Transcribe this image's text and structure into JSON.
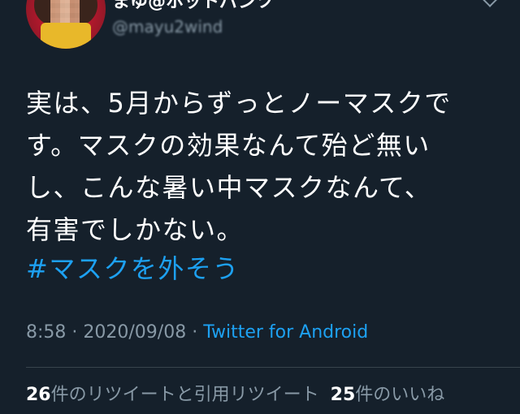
{
  "header": {
    "display_name": "まゆ@ホットパンツ",
    "handle": "@mayu2wind",
    "avatar_icon": "user-avatar",
    "menu_icon": "chevron-down-icon"
  },
  "tweet": {
    "lines": [
      "実は、5月からずっとノーマスクで",
      "す。マスクの効果なんて殆ど無い",
      "し、こんな暑い中マスクなんて、",
      "有害でしかない。"
    ],
    "hashtag": "#マスクを外そう"
  },
  "meta": {
    "time": "8:58",
    "sep1": " · ",
    "date": "2020/09/08",
    "sep2": " · ",
    "source": "Twitter for Android"
  },
  "stats": {
    "retweet_count": "26",
    "retweet_label": "件のリツイートと引用リツイート",
    "like_count": "25",
    "like_label": "件のいいね"
  },
  "colors": {
    "background": "#15202b",
    "text": "#ffffff",
    "secondary": "#8899a6",
    "accent": "#1da1f2",
    "divider": "#38444d"
  }
}
